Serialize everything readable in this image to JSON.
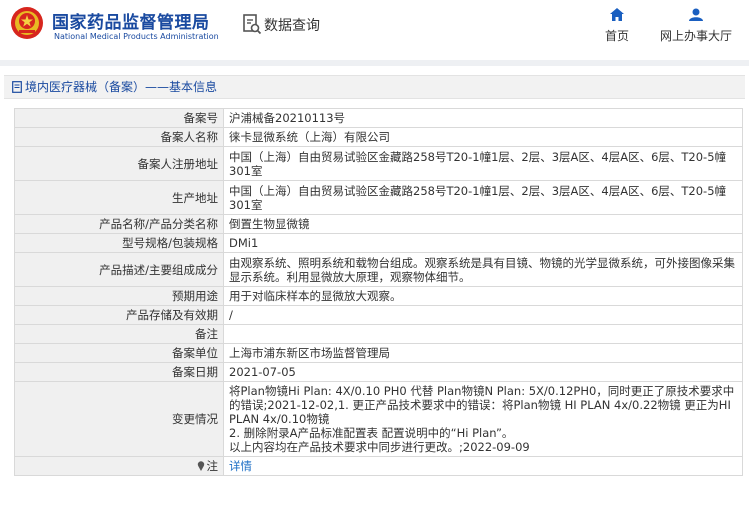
{
  "header": {
    "org_cn": "国家药品监督管理局",
    "org_en": "National Medical Products Administration",
    "query_label": "数据查询",
    "nav_home": "首页",
    "nav_hall": "网上办事大厅"
  },
  "breadcrumb": {
    "text": "境内医疗器械（备案）——基本信息"
  },
  "rows": [
    {
      "label": "备案号",
      "value": "沪浦械备20210113号"
    },
    {
      "label": "备案人名称",
      "value": "徕卡显微系统（上海）有限公司"
    },
    {
      "label": "备案人注册地址",
      "value": "中国（上海）自由贸易试验区金藏路258号T20-1幢1层、2层、3层A区、4层A区、6层、T20-5幢301室"
    },
    {
      "label": "生产地址",
      "value": "中国（上海）自由贸易试验区金藏路258号T20-1幢1层、2层、3层A区、4层A区、6层、T20-5幢301室"
    },
    {
      "label": "产品名称/产品分类名称",
      "value": "倒置生物显微镜"
    },
    {
      "label": "型号规格/包装规格",
      "value": "DMi1"
    },
    {
      "label": "产品描述/主要组成成分",
      "value": "由观察系统、照明系统和载物台组成。观察系统是具有目镜、物镜的光学显微系统，可外接图像采集显示系统。利用显微放大原理，观察物体细节。"
    },
    {
      "label": "预期用途",
      "value": "用于对临床样本的显微放大观察。"
    },
    {
      "label": "产品存储及有效期",
      "value": "/"
    },
    {
      "label": "备注",
      "value": ""
    },
    {
      "label": "备案单位",
      "value": "上海市浦东新区市场监督管理局"
    },
    {
      "label": "备案日期",
      "value": "2021-07-05"
    }
  ],
  "change": {
    "label": "变更情况",
    "lines": [
      "将Plan物镜Hi Plan: 4X/0.10 PH0 代替 Plan物镜N Plan: 5X/0.12PH0，同时更正了原技术要求中的错误;2021-12-02,1. 更正产品技术要求中的错误：将Plan物镜 HI PLAN 4x/0.22物镜 更正为HI PLAN 4x/0.10物镜",
      "2. 删除附录A产品标准配置表 配置说明中的“Hi Plan”。",
      "以上内容均在产品技术要求中同步进行更改。;2022-09-09"
    ]
  },
  "note": {
    "label": "注",
    "link": "详情"
  }
}
